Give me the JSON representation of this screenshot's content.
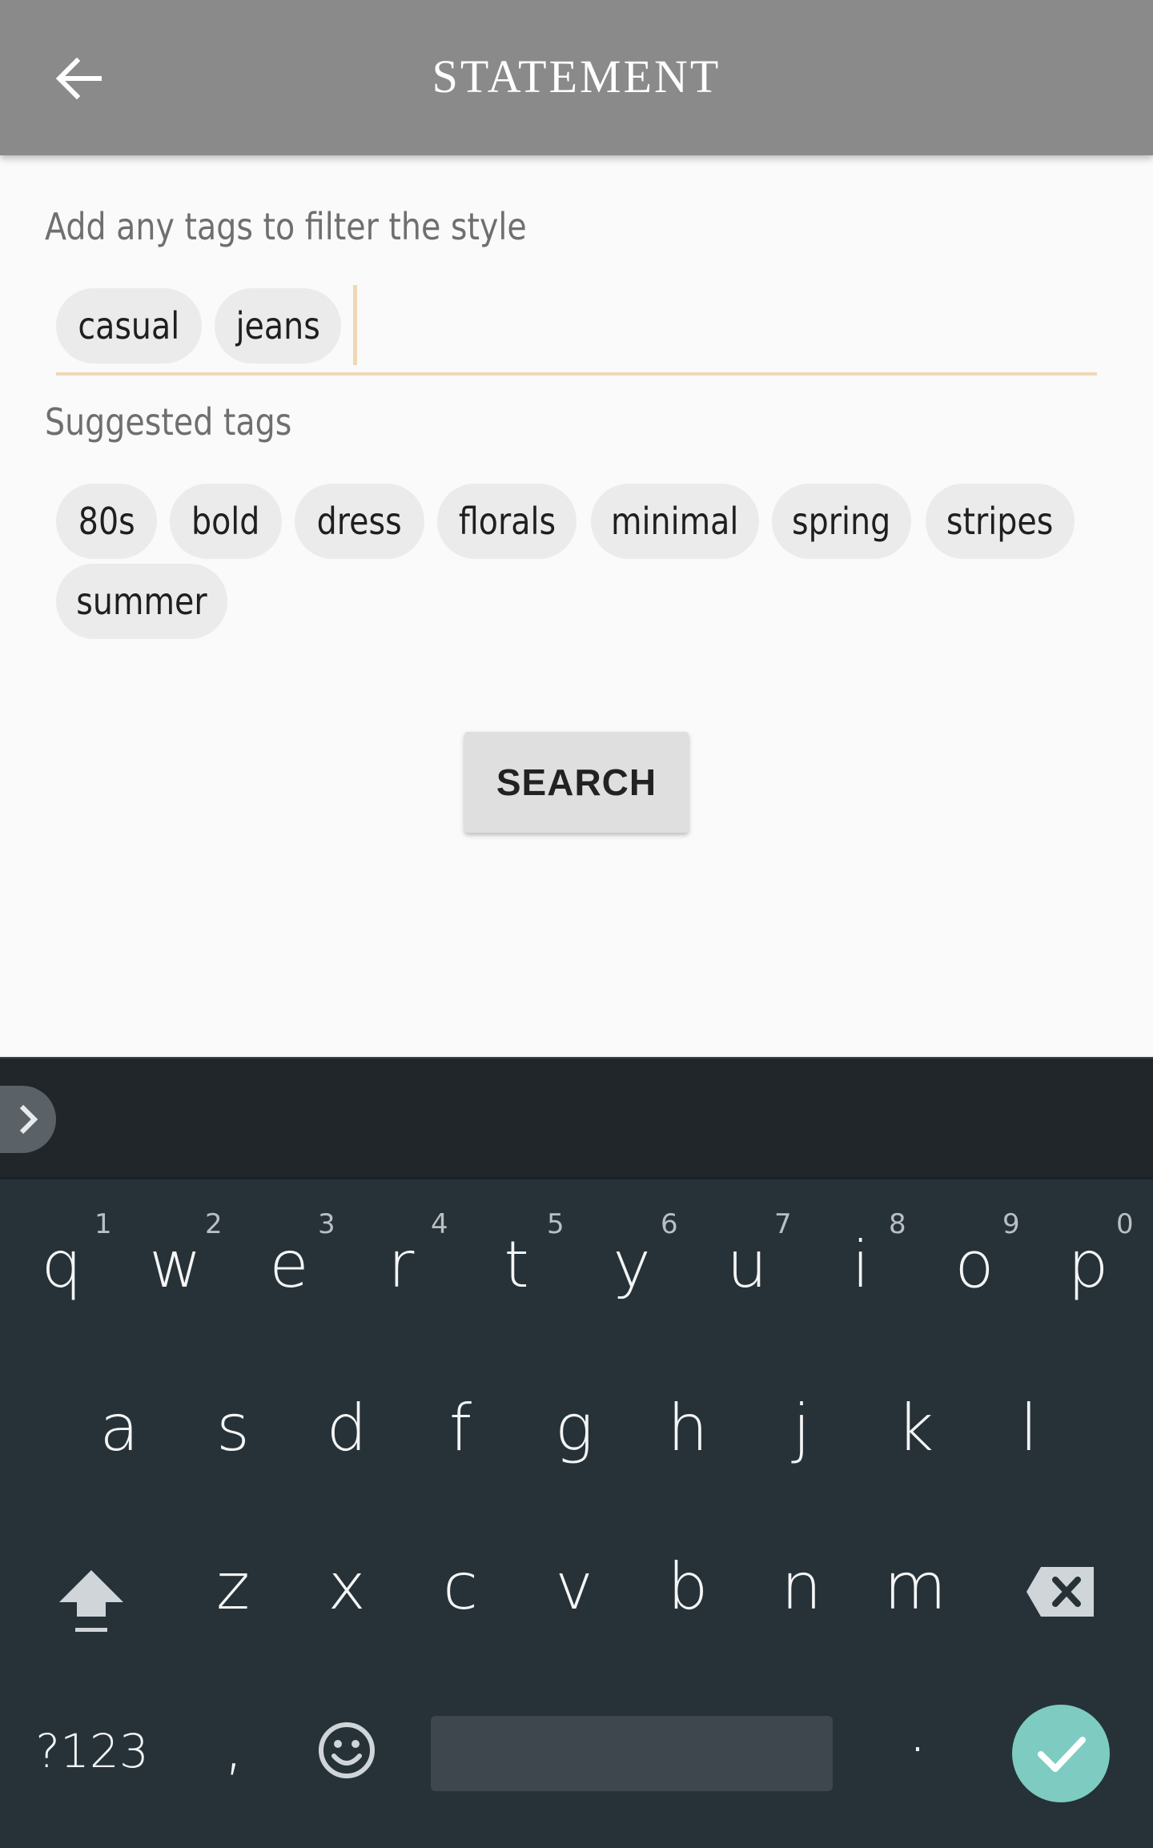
{
  "header": {
    "title": "STATEMENT",
    "back_icon": "arrow-left-icon"
  },
  "tags_section": {
    "label": "Add any tags to filter the style",
    "selected_tags": [
      "casual",
      "jeans"
    ],
    "input_value": ""
  },
  "suggested_section": {
    "label": "Suggested tags",
    "tags": [
      "80s",
      "bold",
      "dress",
      "florals",
      "minimal",
      "spring",
      "stripes",
      "summer"
    ]
  },
  "search_button": {
    "label": "SEARCH"
  },
  "keyboard": {
    "row1": [
      {
        "key": "q",
        "hint": "1"
      },
      {
        "key": "w",
        "hint": "2"
      },
      {
        "key": "e",
        "hint": "3"
      },
      {
        "key": "r",
        "hint": "4"
      },
      {
        "key": "t",
        "hint": "5"
      },
      {
        "key": "y",
        "hint": "6"
      },
      {
        "key": "u",
        "hint": "7"
      },
      {
        "key": "i",
        "hint": "8"
      },
      {
        "key": "o",
        "hint": "9"
      },
      {
        "key": "p",
        "hint": "0"
      }
    ],
    "row2": [
      "a",
      "s",
      "d",
      "f",
      "g",
      "h",
      "j",
      "k",
      "l"
    ],
    "row3": [
      "z",
      "x",
      "c",
      "v",
      "b",
      "n",
      "m"
    ],
    "symbols_label": "?123",
    "comma": ",",
    "period": ".",
    "accent_color": "#7ecbc1"
  },
  "colors": {
    "header_bg": "#8a8a8a",
    "input_underline": "#efd8b6",
    "chip_bg": "#ebebeb",
    "keyboard_bg": "#263238"
  }
}
